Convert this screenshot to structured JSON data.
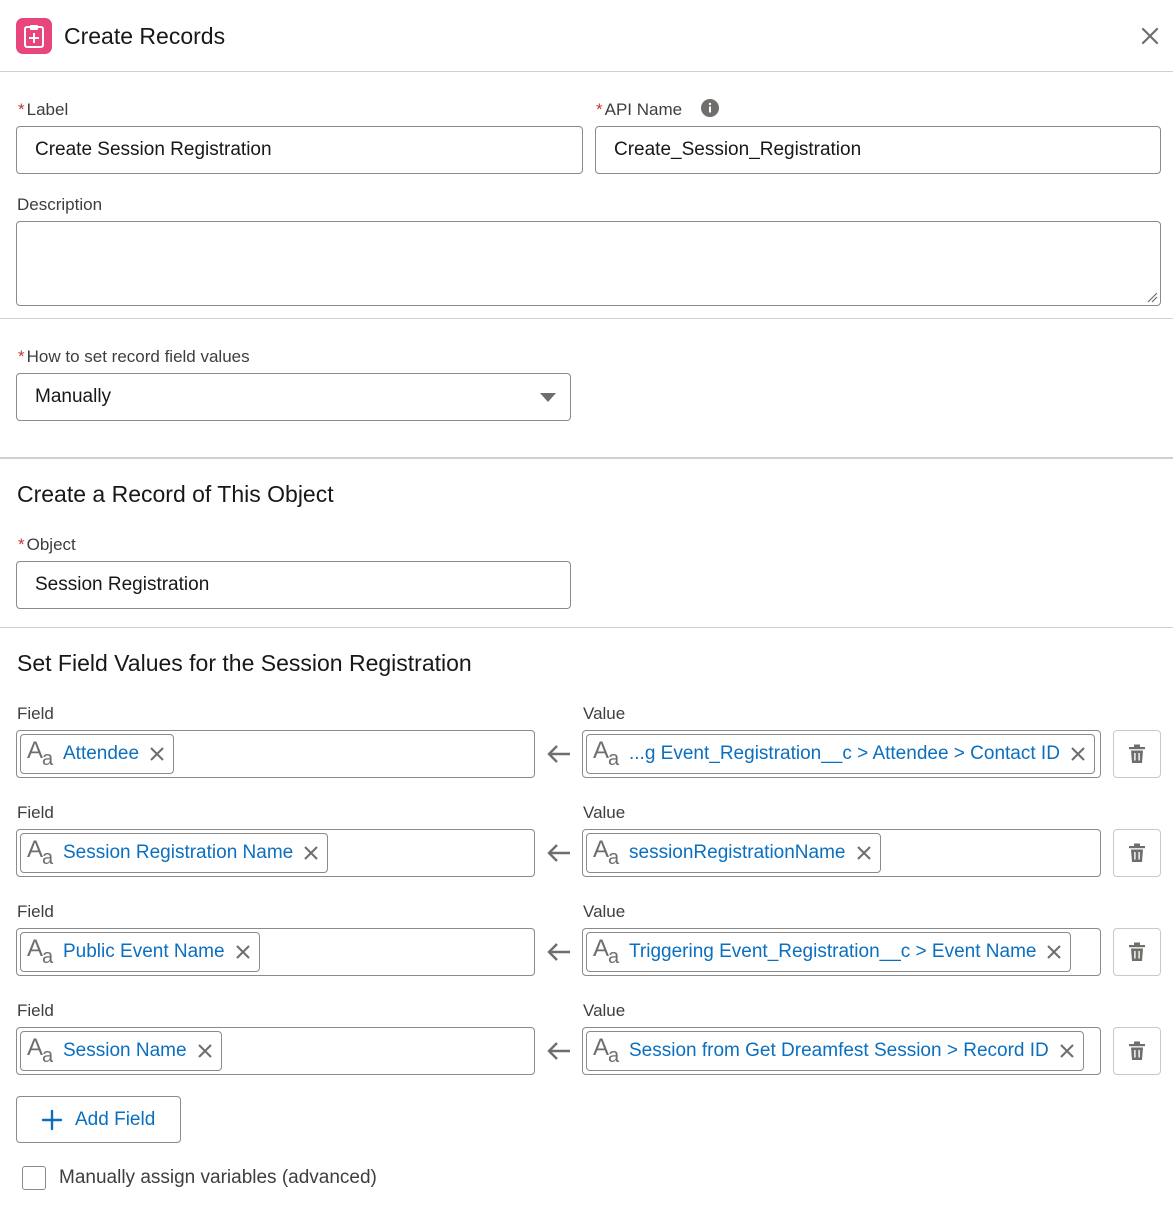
{
  "dialog": {
    "title": "Create Records",
    "icon": "create-records-icon",
    "accent_color": "#e9457d"
  },
  "form": {
    "required_marker": "*",
    "label_field": {
      "label": "Label",
      "value": "Create Session Registration"
    },
    "api_name_field": {
      "label": "API Name",
      "value": "Create_Session_Registration",
      "info_icon": "info-icon"
    },
    "description_field": {
      "label": "Description",
      "value": ""
    },
    "how_to_set": {
      "label": "How to set record field values",
      "value": "Manually"
    }
  },
  "object_section": {
    "title": "Create a Record of This Object",
    "object_field": {
      "label": "Object",
      "value": "Session Registration"
    }
  },
  "field_values_section": {
    "title": "Set Field Values for the Session Registration",
    "field_label": "Field",
    "value_label": "Value",
    "rows": [
      {
        "field": "Attendee",
        "value": "...g Event_Registration__c > Attendee > Contact ID"
      },
      {
        "field": "Session Registration Name",
        "value": "sessionRegistrationName"
      },
      {
        "field": "Public Event Name",
        "value": "Triggering Event_Registration__c > Event Name"
      },
      {
        "field": "Session Name",
        "value": "Session from Get Dreamfest Session > Record ID"
      }
    ],
    "add_field_label": "Add Field"
  },
  "advanced": {
    "checkbox_label": "Manually assign variables (advanced)",
    "checked": false
  },
  "colors": {
    "link_blue": "#0b6fc0",
    "required_red": "#c23934",
    "border": "#8a8a8a"
  }
}
